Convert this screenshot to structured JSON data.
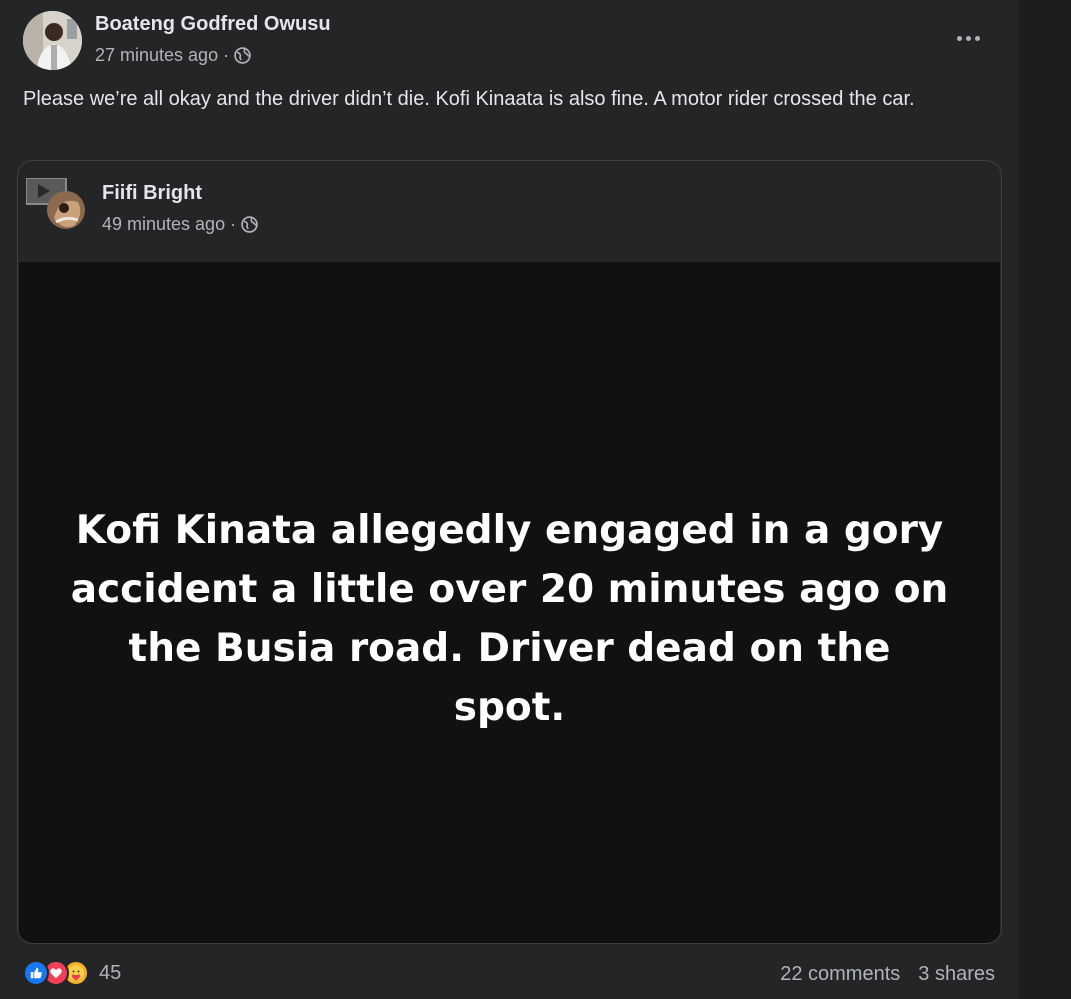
{
  "post": {
    "author": "Boateng Godfred Owusu",
    "time": "27 minutes ago",
    "separator": "·",
    "privacy_icon": "globe-icon",
    "text": "Please we’re all okay and the driver didn’t die. Kofi Kinaata is also fine. A motor rider crossed the car."
  },
  "shared_post": {
    "author": "Fiifi Bright",
    "time": "49 minutes ago",
    "separator": "·",
    "privacy_icon": "globe-icon",
    "card_text": "Kofi Kinata allegedly engaged in a gory accident a little over 20 minutes ago on the Busia road. Driver dead on the spot.",
    "card_background": "#111112"
  },
  "footer": {
    "reaction_icons": [
      "like-icon",
      "love-icon",
      "care-icon"
    ],
    "reaction_count": "45",
    "comments": "22 comments",
    "shares": "3 shares"
  },
  "colors": {
    "post_background": "#242526",
    "primary_text": "#e4e6eb",
    "secondary_text": "#b0b3b8",
    "like": "#1877f2",
    "love": "#f33e58",
    "care": "#f7b125"
  }
}
